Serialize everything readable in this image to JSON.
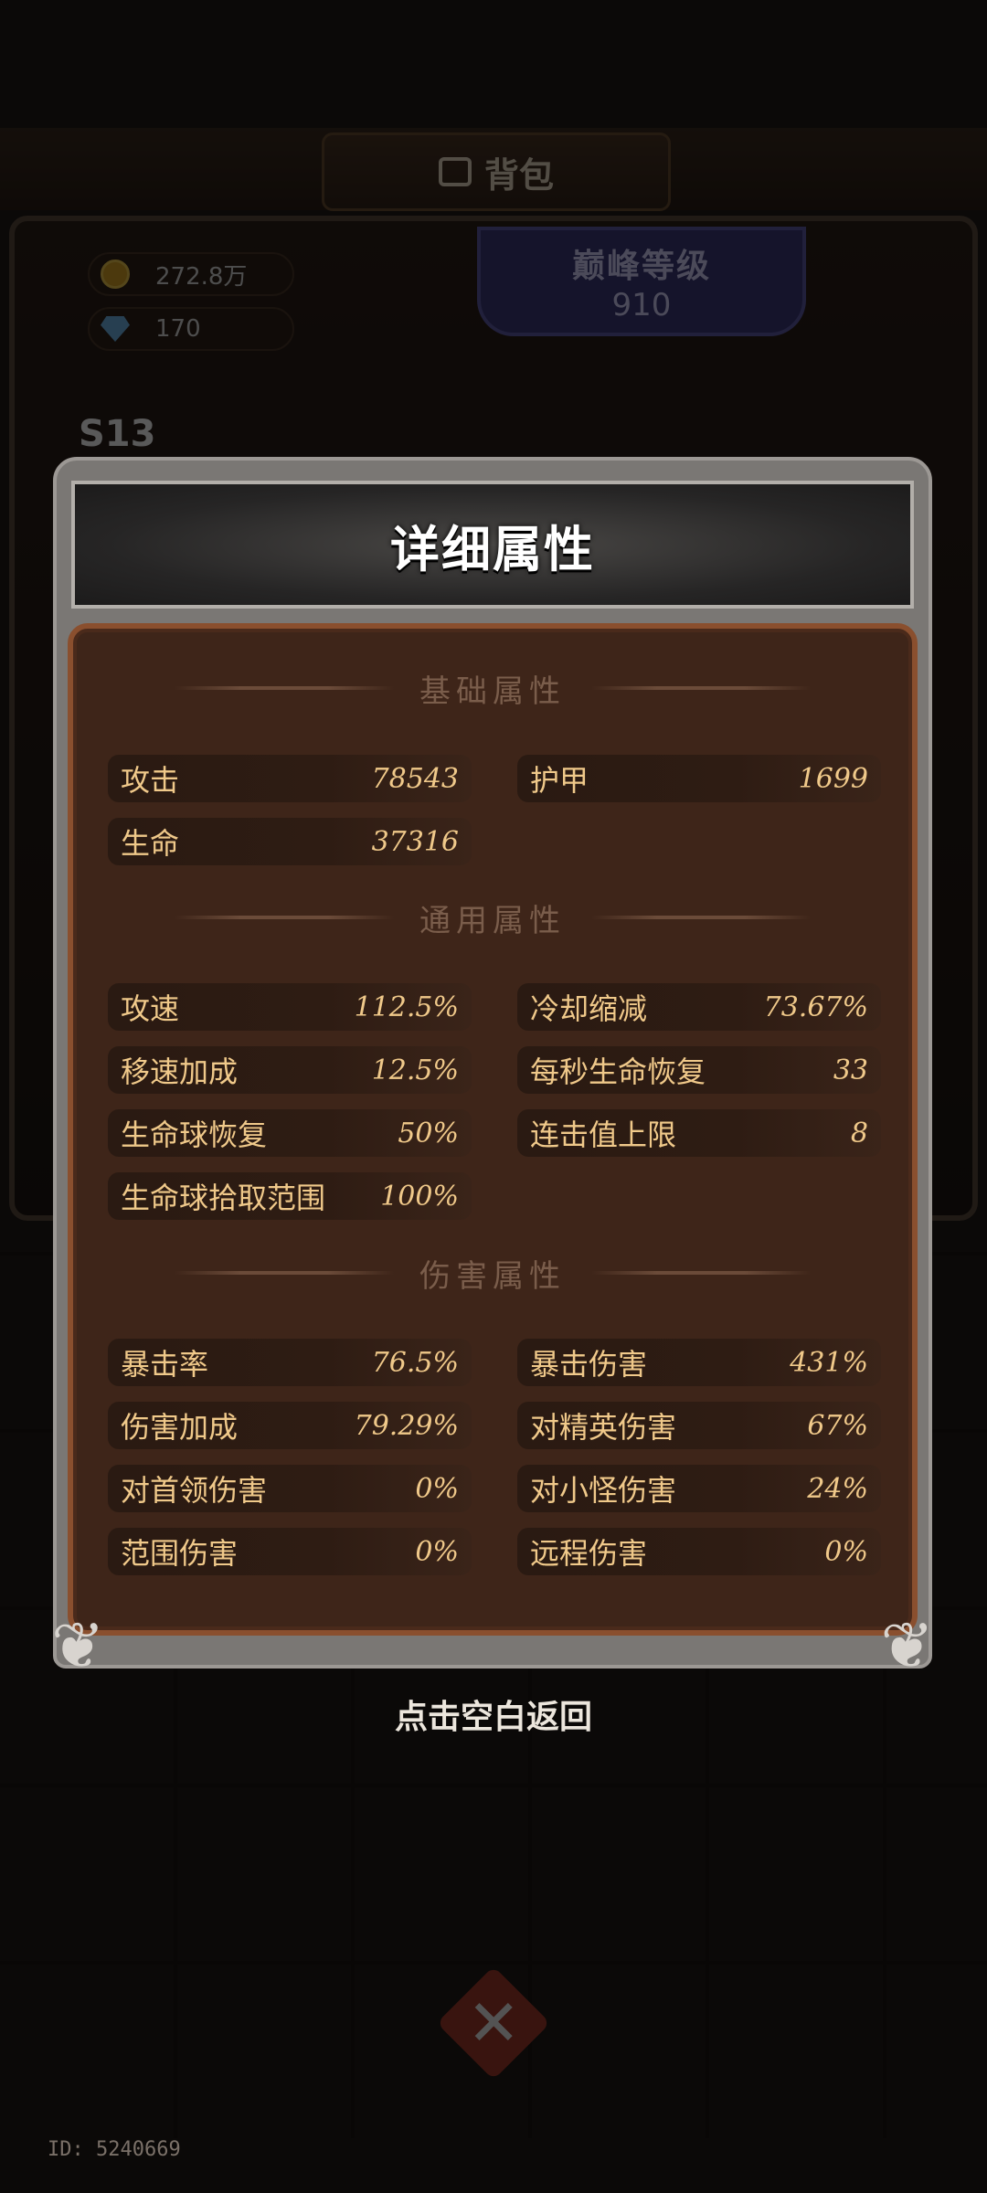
{
  "background": {
    "bag_title": "背包",
    "gold": "272.8万",
    "gems": "170",
    "peak_level_label": "巅峰等级",
    "peak_level_value": "910",
    "season": "S13",
    "player_id": "ID: 5240669"
  },
  "modal": {
    "title": "详细属性",
    "sections": {
      "basic": {
        "title": "基础属性",
        "stats": [
          {
            "label": "攻击",
            "value": "78543"
          },
          {
            "label": "护甲",
            "value": "1699"
          },
          {
            "label": "生命",
            "value": "37316"
          }
        ]
      },
      "general": {
        "title": "通用属性",
        "stats": [
          {
            "label": "攻速",
            "value": "112.5%"
          },
          {
            "label": "冷却缩减",
            "value": "73.67%"
          },
          {
            "label": "移速加成",
            "value": "12.5%"
          },
          {
            "label": "每秒生命恢复",
            "value": "33"
          },
          {
            "label": "生命球恢复",
            "value": "50%"
          },
          {
            "label": "连击值上限",
            "value": "8"
          },
          {
            "label": "生命球拾取范围",
            "value": "100%"
          }
        ]
      },
      "damage": {
        "title": "伤害属性",
        "stats": [
          {
            "label": "暴击率",
            "value": "76.5%"
          },
          {
            "label": "暴击伤害",
            "value": "431%"
          },
          {
            "label": "伤害加成",
            "value": "79.29%"
          },
          {
            "label": "对精英伤害",
            "value": "67%"
          },
          {
            "label": "对首领伤害",
            "value": "0%"
          },
          {
            "label": "对小怪伤害",
            "value": "24%"
          },
          {
            "label": "范围伤害",
            "value": "0%"
          },
          {
            "label": "远程伤害",
            "value": "0%"
          }
        ]
      }
    }
  },
  "hint": "点击空白返回"
}
